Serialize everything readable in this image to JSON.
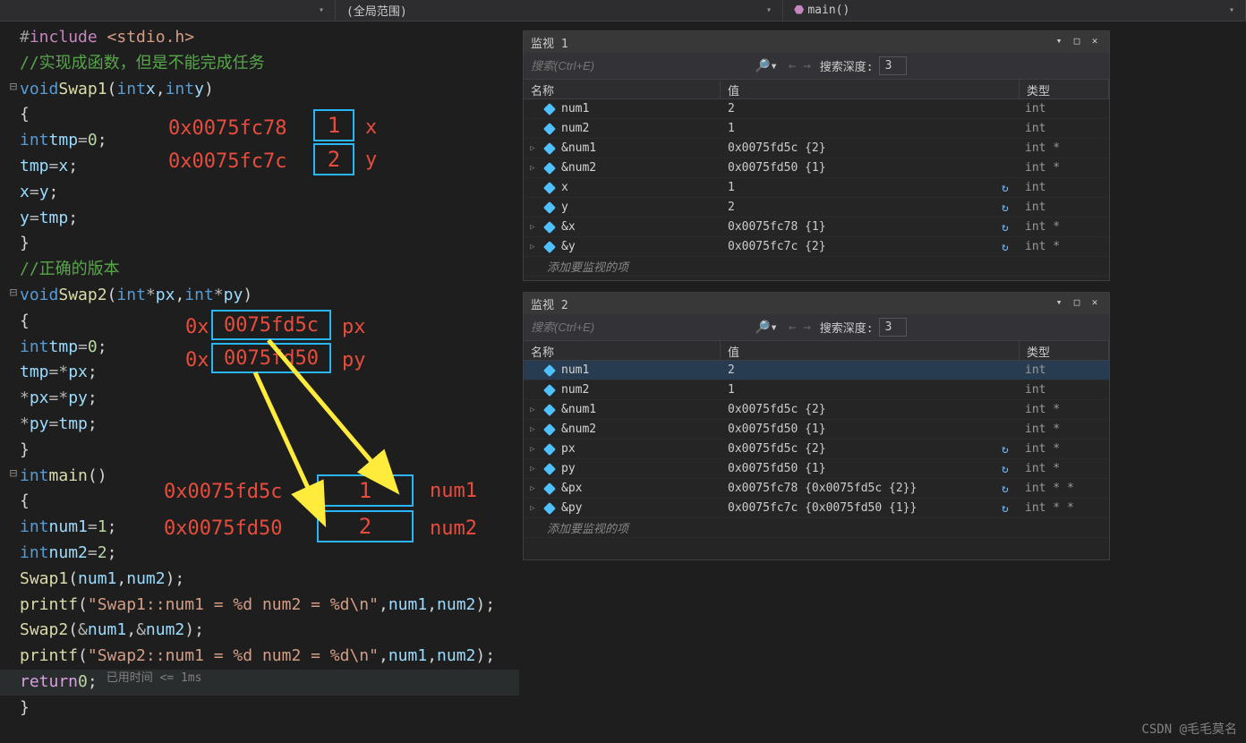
{
  "toolbar": {
    "scope": "(全局范围)",
    "function": "main()"
  },
  "annotations": {
    "addr_x": "0x0075fc78",
    "addr_y": "0x0075fc7c",
    "val_x": "1",
    "val_y": "2",
    "label_x": "x",
    "label_y": "y",
    "addr_px": "0x0075fd5c",
    "addr_py": "0x0075fd50",
    "label_px": "px",
    "label_py": "py",
    "addr_num1": "0x0075fd5c",
    "addr_num2": "0x0075fd50",
    "val_num1": "1",
    "val_num2": "2",
    "label_num1": "num1",
    "label_num2": "num2"
  },
  "code": {
    "timing": "已用时间 <= 1ms"
  },
  "watch1": {
    "title": "监视 1",
    "search_placeholder": "搜索(Ctrl+E)",
    "depth_label": "搜索深度:",
    "depth_value": "3",
    "headers": {
      "name": "名称",
      "value": "值",
      "type": "类型"
    },
    "add_item": "添加要监视的项",
    "rows": [
      {
        "expand": "",
        "name": "num1",
        "value": "2",
        "type": "int",
        "refresh": false
      },
      {
        "expand": "",
        "name": "num2",
        "value": "1",
        "type": "int",
        "refresh": false
      },
      {
        "expand": "▷",
        "name": "&num1",
        "value": "0x0075fd5c {2}",
        "type": "int *",
        "refresh": false
      },
      {
        "expand": "▷",
        "name": "&num2",
        "value": "0x0075fd50 {1}",
        "type": "int *",
        "refresh": false
      },
      {
        "expand": "",
        "name": "x",
        "value": "1",
        "type": "int",
        "refresh": true
      },
      {
        "expand": "",
        "name": "y",
        "value": "2",
        "type": "int",
        "refresh": true
      },
      {
        "expand": "▷",
        "name": "&x",
        "value": "0x0075fc78 {1}",
        "type": "int *",
        "refresh": true
      },
      {
        "expand": "▷",
        "name": "&y",
        "value": "0x0075fc7c {2}",
        "type": "int *",
        "refresh": true
      }
    ]
  },
  "watch2": {
    "title": "监视 2",
    "search_placeholder": "搜索(Ctrl+E)",
    "depth_label": "搜索深度:",
    "depth_value": "3",
    "headers": {
      "name": "名称",
      "value": "值",
      "type": "类型"
    },
    "add_item": "添加要监视的项",
    "rows": [
      {
        "expand": "",
        "name": "num1",
        "value": "2",
        "type": "int",
        "refresh": false,
        "selected": true
      },
      {
        "expand": "",
        "name": "num2",
        "value": "1",
        "type": "int",
        "refresh": false
      },
      {
        "expand": "▷",
        "name": "&num1",
        "value": "0x0075fd5c {2}",
        "type": "int *",
        "refresh": false
      },
      {
        "expand": "▷",
        "name": "&num2",
        "value": "0x0075fd50 {1}",
        "type": "int *",
        "refresh": false
      },
      {
        "expand": "▷",
        "name": "px",
        "value": "0x0075fd5c {2}",
        "type": "int *",
        "refresh": true
      },
      {
        "expand": "▷",
        "name": "py",
        "value": "0x0075fd50 {1}",
        "type": "int *",
        "refresh": true
      },
      {
        "expand": "▷",
        "name": "&px",
        "value": "0x0075fc78 {0x0075fd5c {2}}",
        "type": "int * *",
        "refresh": true
      },
      {
        "expand": "▷",
        "name": "&py",
        "value": "0x0075fc7c {0x0075fd50 {1}}",
        "type": "int * *",
        "refresh": true
      }
    ]
  },
  "watermark": "CSDN @毛毛莫名"
}
